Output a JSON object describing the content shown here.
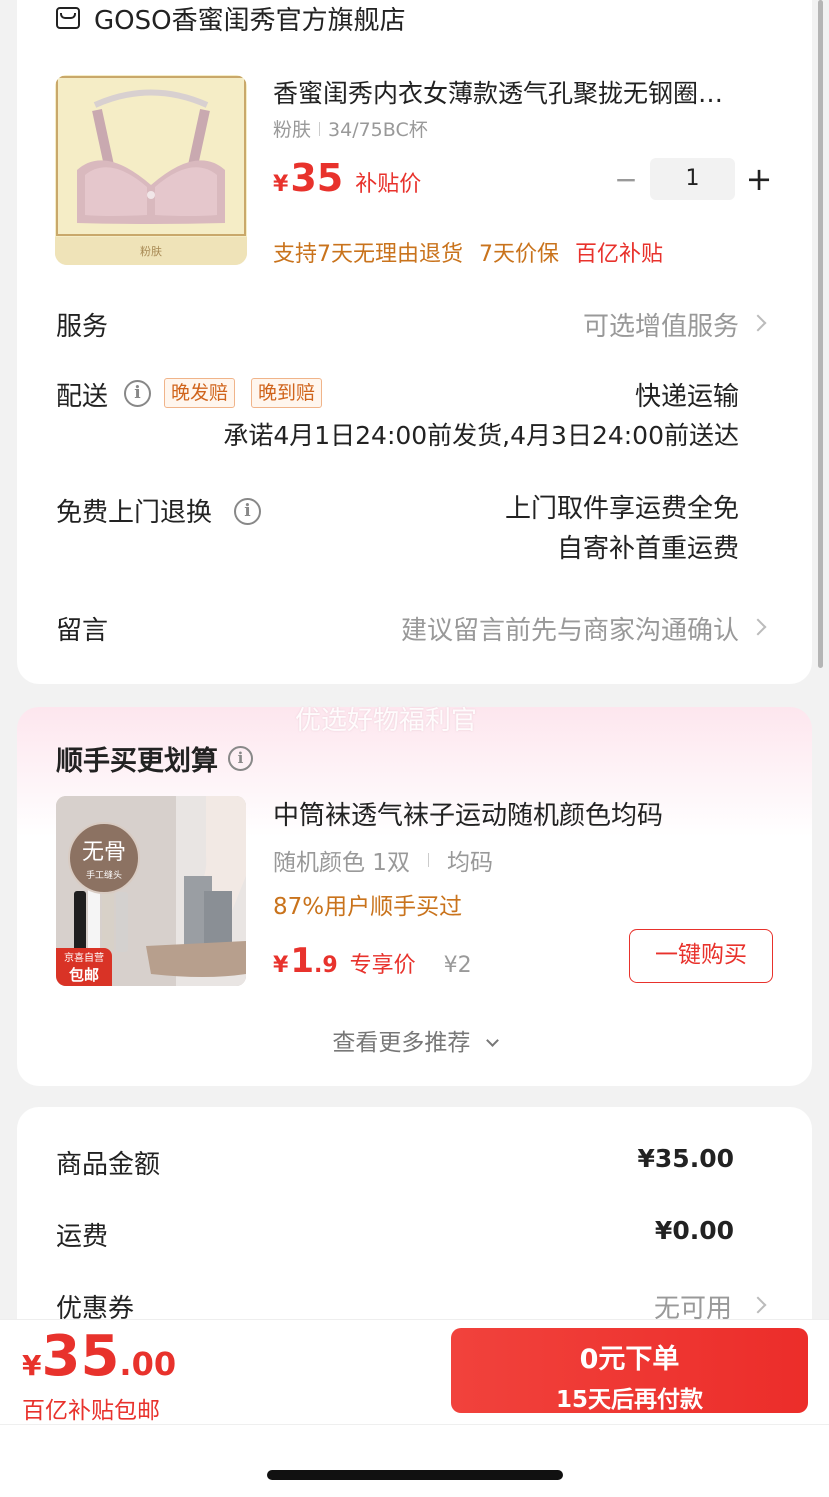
{
  "store": {
    "name": "GOSO香蜜闺秀官方旗舰店"
  },
  "product": {
    "title": "香蜜闺秀内衣女薄款透气孔聚拢无钢圈…",
    "spec_color": "粉肤",
    "spec_size": "34/75BC杯",
    "image_caption": "粉肤",
    "currency": "¥",
    "price": "35",
    "price_label": "补贴价",
    "qty_minus": "−",
    "quantity": "1",
    "qty_plus": "+",
    "guarantees": [
      "支持7天无理由退货",
      "7天价保"
    ],
    "subsidy_tag": "百亿补贴"
  },
  "service": {
    "label": "服务",
    "value": "可选增值服务"
  },
  "delivery": {
    "label": "配送",
    "tags": [
      "晚发赔",
      "晚到赔"
    ],
    "method": "快递运输",
    "promise": "承诺4月1日24:00前发货,4月3日24:00前送达"
  },
  "return_service": {
    "label": "免费上门退换",
    "line1": "上门取件享运费全免",
    "line2": "自寄补首重运费"
  },
  "message": {
    "label": "留言",
    "placeholder": "建议留言前先与商家沟通确认"
  },
  "recommend": {
    "banner": "优选好物福利官",
    "title": "顺手买更划算",
    "item": {
      "title": "中筒袜透气袜子运动随机颜色均码",
      "spec_color": "随机颜色 1双",
      "spec_size": "均码",
      "social": "87%用户顺手买过",
      "currency": "¥",
      "price_int": "1",
      "price_dec": ".9",
      "price_label": "专享价",
      "original_price": "¥2",
      "buy_button": "一键购买",
      "badge_top": "京喜自营",
      "badge_bottom": "包邮",
      "stamp_main": "无骨",
      "stamp_sub": "手工缝头"
    },
    "more": "查看更多推荐"
  },
  "summary": {
    "goods_label": "商品金额",
    "goods_value": "¥35.00",
    "shipping_label": "运费",
    "shipping_value": "¥0.00",
    "coupon_label": "优惠券",
    "coupon_value": "无可用"
  },
  "bottom_bar": {
    "currency": "¥",
    "total_int": "35",
    "total_dec": ".00",
    "subtitle": "百亿补贴包邮",
    "cta_line1": "0元下单",
    "cta_line2": "15天后再付款"
  },
  "colors": {
    "accent_red": "#e8322c",
    "accent_orange": "#c9731c",
    "page_bg": "#f2f2f2"
  }
}
